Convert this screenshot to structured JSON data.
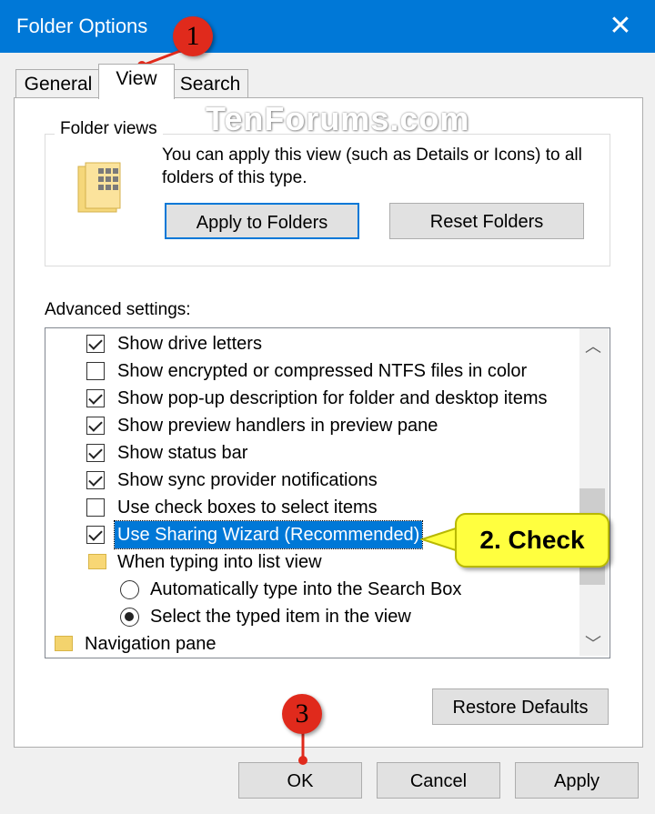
{
  "window": {
    "title": "Folder Options",
    "close_glyph": "✕"
  },
  "tabs": [
    {
      "label": "General",
      "active": false
    },
    {
      "label": "View",
      "active": true
    },
    {
      "label": "Search",
      "active": false
    }
  ],
  "folder_views": {
    "label": "Folder views",
    "description": "You can apply this view (such as Details or Icons) to all folders of this type.",
    "apply_button": "Apply to Folders",
    "reset_button": "Reset Folders",
    "icon": "folder-view-icon"
  },
  "advanced": {
    "label": "Advanced settings:",
    "items": [
      {
        "type": "checkbox",
        "label": "Show drive letters",
        "checked": true
      },
      {
        "type": "checkbox",
        "label": "Show encrypted or compressed NTFS files in color",
        "checked": false
      },
      {
        "type": "checkbox",
        "label": "Show pop-up description for folder and desktop items",
        "checked": true
      },
      {
        "type": "checkbox",
        "label": "Show preview handlers in preview pane",
        "checked": true
      },
      {
        "type": "checkbox",
        "label": "Show status bar",
        "checked": true
      },
      {
        "type": "checkbox",
        "label": "Show sync provider notifications",
        "checked": true
      },
      {
        "type": "checkbox",
        "label": "Use check boxes to select items",
        "checked": false
      },
      {
        "type": "checkbox",
        "label": "Use Sharing Wizard (Recommended)",
        "checked": true,
        "selected": true
      },
      {
        "type": "folder",
        "label": "When typing into list view"
      },
      {
        "type": "radio",
        "label": "Automatically type into the Search Box",
        "checked": false
      },
      {
        "type": "radio",
        "label": "Select the typed item in the view",
        "checked": true
      },
      {
        "type": "folder",
        "label": "Navigation pane"
      }
    ],
    "restore_button": "Restore Defaults"
  },
  "footer": {
    "ok": "OK",
    "cancel": "Cancel",
    "apply": "Apply"
  },
  "annotations": {
    "step1": "1",
    "step2": "2. Check",
    "step3": "3",
    "watermark": "TenForums.com"
  },
  "colors": {
    "accent": "#0078d7",
    "badge": "#e02a1c",
    "callout": "#ffff3f"
  }
}
